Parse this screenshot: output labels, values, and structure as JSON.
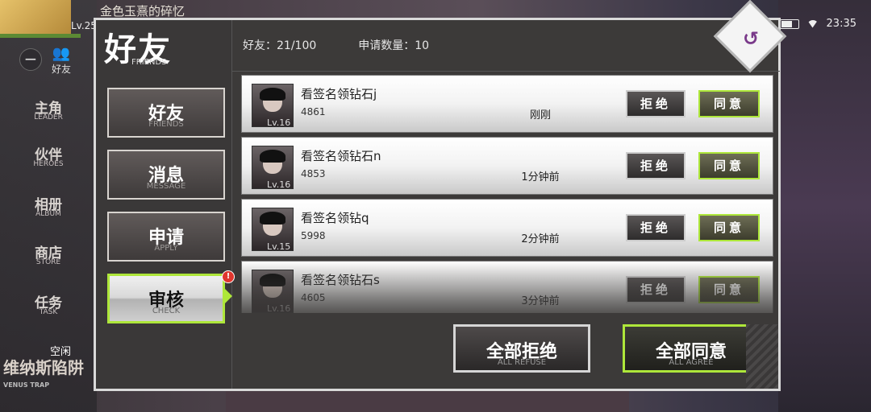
{
  "background": {
    "title_text": "金色玉熹的碎忆",
    "level_text": "Lv.25",
    "time": "23:35",
    "side_menu": [
      {
        "cn": "主角",
        "en": "LEADER"
      },
      {
        "cn": "伙伴",
        "en": "HEROES"
      },
      {
        "cn": "相册",
        "en": "ALBUM"
      },
      {
        "cn": "商店",
        "en": "STORE"
      },
      {
        "cn": "任务",
        "en": "TASK"
      }
    ],
    "friends_mini_label": "好友",
    "idle_label": "空闲",
    "event_cn": "维纳斯陷阱",
    "event_en": "VENUS TRAP"
  },
  "dialog": {
    "title_cn": "好友",
    "title_en": "FRIENDS",
    "tabs": [
      {
        "cn": "好友",
        "en": "FRIENDS"
      },
      {
        "cn": "消息",
        "en": "MESSAGE"
      },
      {
        "cn": "申请",
        "en": "APPLY"
      },
      {
        "cn": "审核",
        "en": "CHECK"
      }
    ],
    "active_tab": "审核",
    "badge": "!",
    "friends_count_label": "好友：21/100",
    "requests_count_label": "申请数量：10",
    "back_icon": "↺"
  },
  "requests": [
    {
      "name": "看签名领钻石j",
      "id": "4861",
      "level": "Lv.16",
      "time": "刚刚"
    },
    {
      "name": "看签名领钻石n",
      "id": "4853",
      "level": "Lv.16",
      "time": "1分钟前"
    },
    {
      "name": "看签名领钻q",
      "id": "5998",
      "level": "Lv.15",
      "time": "2分钟前"
    },
    {
      "name": "看签名领钻石s",
      "id": "4605",
      "level": "Lv.16",
      "time": "3分钟前"
    }
  ],
  "row_buttons": {
    "reject": "拒绝",
    "agree": "同意"
  },
  "bottom_buttons": {
    "all_reject_cn": "全部拒绝",
    "all_reject_en": "ALL REFUSE",
    "all_agree_cn": "全部同意",
    "all_agree_en": "ALL AGREE"
  },
  "colors": {
    "accent_green": "#aee73a",
    "dialog_bg": "#3c3a39",
    "badge_red": "#e0362e"
  }
}
